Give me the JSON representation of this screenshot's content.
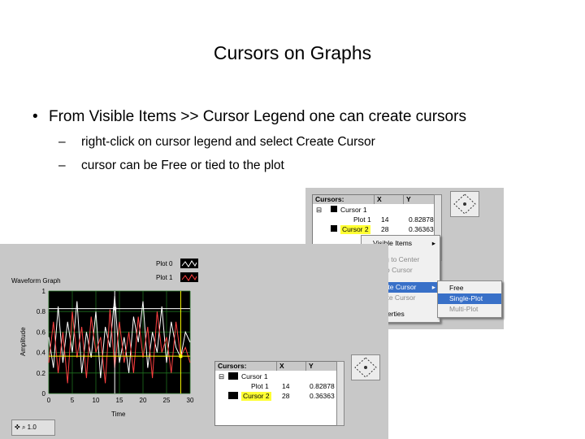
{
  "slide": {
    "title": "Cursors on Graphs",
    "bullet": "From Visible Items >> Cursor Legend one can create cursors",
    "sub1": "right-click on cursor legend and select Create Cursor",
    "sub2": "cursor can be Free or tied to the plot",
    "bullet_glyph": "•",
    "dash_glyph": "–"
  },
  "legend_top": {
    "headers": [
      "Cursors:",
      "X",
      "Y"
    ],
    "rows": [
      {
        "name": "Cursor 1",
        "x": "",
        "y": ""
      },
      {
        "name": "Plot 1",
        "x": "14",
        "y": "0.82878"
      },
      {
        "name": "Cursor 2",
        "x": "28",
        "y": "0.36363"
      }
    ]
  },
  "context_menu": {
    "items": [
      "Visible Items",
      "Bring to Center",
      "Go to Cursor",
      "Create Cursor",
      "Delete Cursor",
      "Properties"
    ],
    "submenu": [
      "Free",
      "Single-Plot",
      "Multi-Plot"
    ]
  },
  "graph": {
    "title": "Waveform Graph",
    "plot_legend": [
      "Plot 0",
      "Plot 1"
    ],
    "ylabel": "Amplitude",
    "xlabel": "Time",
    "y_ticks": [
      "1",
      "0.8",
      "0.6",
      "0.4",
      "0.2",
      "0"
    ],
    "x_ticks": [
      "0",
      "5",
      "10",
      "15",
      "20",
      "25",
      "30"
    ],
    "palette_text": "1.0"
  },
  "legend_bottom": {
    "headers": [
      "Cursors:",
      "X",
      "Y"
    ],
    "rows": [
      {
        "name": "Cursor 1",
        "x": "",
        "y": ""
      },
      {
        "name": "Plot 1",
        "x": "14",
        "y": "0.82878"
      },
      {
        "name": "Cursor 2",
        "x": "28",
        "y": "0.36363"
      }
    ]
  },
  "chart_data": {
    "type": "line",
    "title": "Waveform Graph",
    "xlabel": "Time",
    "ylabel": "Amplitude",
    "xlim": [
      0,
      30
    ],
    "ylim": [
      0,
      1
    ],
    "series": [
      {
        "name": "Plot 0",
        "color": "#ffffff",
        "values": [
          0.55,
          0.25,
          0.85,
          0.3,
          0.7,
          0.4,
          0.9,
          0.2,
          0.6,
          0.35,
          0.8,
          0.15,
          0.65,
          0.45,
          0.95,
          0.3,
          0.55,
          0.2,
          0.75,
          0.5,
          0.9,
          0.25,
          0.6,
          0.4,
          0.85,
          0.3,
          0.7,
          0.45,
          0.35,
          0.6,
          0.5
        ]
      },
      {
        "name": "Plot 1",
        "color": "#ff4040",
        "values": [
          0.3,
          0.7,
          0.2,
          0.6,
          0.1,
          0.8,
          0.35,
          0.65,
          0.15,
          0.75,
          0.4,
          0.55,
          0.1,
          0.82,
          0.25,
          0.7,
          0.3,
          0.6,
          0.2,
          0.75,
          0.35,
          0.65,
          0.15,
          0.8,
          0.4,
          0.55,
          0.2,
          0.7,
          0.36,
          0.45,
          0.3
        ]
      }
    ],
    "cursors": [
      {
        "name": "Cursor 1",
        "x": 14,
        "y": 0.82878,
        "color": "#ffffff"
      },
      {
        "name": "Cursor 2",
        "x": 28,
        "y": 0.36363,
        "color": "#ffff00"
      }
    ]
  }
}
